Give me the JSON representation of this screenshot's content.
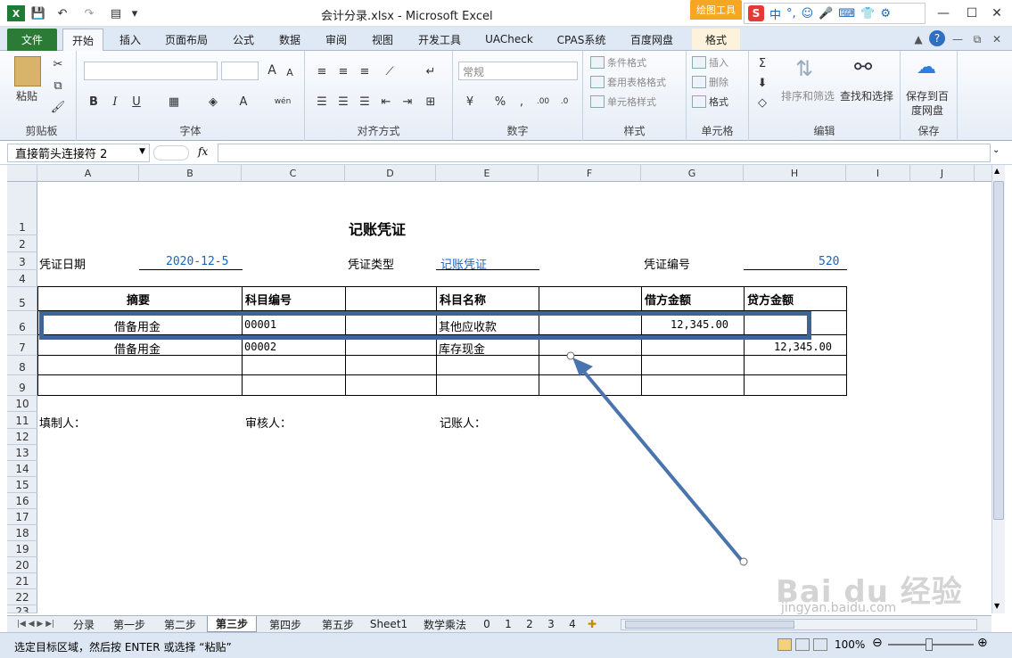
{
  "window": {
    "title": "会计分录.xlsx - Microsoft Excel",
    "draw_tools": "绘图工具",
    "ime": [
      "S",
      "中",
      "°,",
      "☺",
      "🎤",
      "⌨",
      "👕",
      "⚙"
    ]
  },
  "tabs": {
    "file": "文件",
    "items": [
      "开始",
      "插入",
      "页面布局",
      "公式",
      "数据",
      "审阅",
      "视图",
      "开发工具",
      "UACheck",
      "CPAS系统",
      "百度网盘",
      "格式"
    ]
  },
  "ribbon": {
    "clipboard": {
      "label": "剪贴板",
      "paste": "粘贴"
    },
    "font": {
      "label": "字体",
      "bold": "B",
      "italic": "I",
      "underline": "U",
      "grow": "A",
      "shrink": "A",
      "color": "A",
      "wen": "wén"
    },
    "align": {
      "label": "对齐方式"
    },
    "number": {
      "label": "数字",
      "format": "常规",
      "percent": "%"
    },
    "styles": {
      "label": "样式",
      "cond": "条件格式",
      "table": "套用表格格式",
      "cell": "单元格样式"
    },
    "cells": {
      "label": "单元格",
      "insert": "插入",
      "delete": "删除",
      "format": "格式"
    },
    "edit": {
      "label": "编辑",
      "sort": "排序和筛选",
      "find": "查找和选择"
    },
    "save": {
      "label": "保存",
      "btn1": "保存到百",
      "btn2": "度网盘"
    }
  },
  "formula_bar": {
    "name_box": "直接箭头连接符 2",
    "fx": "fx",
    "value": ""
  },
  "columns": [
    "A",
    "B",
    "C",
    "D",
    "E",
    "F",
    "G",
    "H",
    "I",
    "J"
  ],
  "rows": [
    "1",
    "2",
    "3",
    "4",
    "5",
    "6",
    "7",
    "8",
    "9",
    "10",
    "11",
    "12",
    "13",
    "14",
    "15",
    "16",
    "17",
    "18",
    "19",
    "20",
    "21",
    "22",
    "23"
  ],
  "voucher": {
    "title": "记账凭证",
    "date_label": "凭证日期",
    "date_value": "2020-12-5",
    "type_label": "凭证类型",
    "type_value": "记账凭证",
    "no_label": "凭证编号",
    "no_value": "520",
    "headers": [
      "摘要",
      "科目编号",
      "科目名称",
      "借方金额",
      "贷方金额"
    ],
    "entries": [
      {
        "summary": "借备用金",
        "code": "00001",
        "name": "其他应收款",
        "debit": "12,345.00",
        "credit": ""
      },
      {
        "summary": "借备用金",
        "code": "00002",
        "name": "库存现金",
        "debit": "",
        "credit": "12,345.00"
      }
    ],
    "preparer": "填制人：",
    "reviewer": "审核人：",
    "bookkeeper": "记账人："
  },
  "sheets": [
    "分录",
    "第一步",
    "第二步",
    "第三步",
    "第四步",
    "第五步",
    "Sheet1",
    "数学乘法",
    "0",
    "1",
    "2",
    "3",
    "4"
  ],
  "active_sheet": "第三步",
  "status": {
    "message": "选定目标区域，然后按 ENTER 或选择 “粘贴”",
    "zoom": "100%"
  },
  "watermark": {
    "brand": "Bai du 经验",
    "url": "jingyan.baidu.com"
  },
  "colors": {
    "file_tab": "#2b7a36",
    "highlight_box": "#3e6596",
    "arrow": "#4a74ad",
    "blue_text": "#1565c0"
  }
}
